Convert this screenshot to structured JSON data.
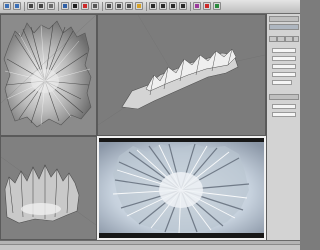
{
  "toolbar": {
    "buttons": [
      {
        "name": "undo-button",
        "icon": "undo-icon",
        "color": "#3b6fb6"
      },
      {
        "name": "redo-button",
        "icon": "redo-icon",
        "color": "#3b6fb6"
      },
      {
        "name": "link-button",
        "icon": "link-icon",
        "color": "#444444"
      },
      {
        "name": "unlink-button",
        "icon": "unlink-icon",
        "color": "#444444"
      },
      {
        "name": "bind-space-warp-button",
        "icon": "warp-icon",
        "color": "#6c6c6c"
      },
      {
        "name": "select-filter-button",
        "icon": "filter-icon",
        "color": "#2f5fa5"
      },
      {
        "name": "select-object-button",
        "icon": "arrow-icon",
        "color": "#1e1e1e"
      },
      {
        "name": "select-by-name-button",
        "icon": "list-icon",
        "color": "#cc2a2a"
      },
      {
        "name": "region-select-button",
        "icon": "region-icon",
        "color": "#555555"
      },
      {
        "name": "move-button",
        "icon": "move-icon",
        "color": "#4a4a4a"
      },
      {
        "name": "rotate-button",
        "icon": "rotate-icon",
        "color": "#4a4a4a"
      },
      {
        "name": "scale-button",
        "icon": "scale-icon",
        "color": "#4a4a4a"
      },
      {
        "name": "pivot-button",
        "icon": "pivot-icon",
        "color": "#d6a126"
      },
      {
        "name": "snap-button",
        "icon": "magnet-icon",
        "color": "#2b2b2b"
      },
      {
        "name": "angle-snap-button",
        "icon": "angle-snap-icon",
        "color": "#2b2b2b"
      },
      {
        "name": "mirror-button",
        "icon": "mirror-icon",
        "color": "#2b2b2b"
      },
      {
        "name": "align-button",
        "icon": "align-icon",
        "color": "#2b2b2b"
      },
      {
        "name": "material-editor-button",
        "icon": "material-icon",
        "color": "#9b3b9b"
      },
      {
        "name": "render-setup-button",
        "icon": "render-setup-icon",
        "color": "#cc2a2a"
      },
      {
        "name": "quick-render-button",
        "icon": "teapot-icon",
        "color": "#2b8a3e"
      }
    ]
  },
  "viewports": {
    "top": {
      "content": "terrain-top-view",
      "active": false
    },
    "perspective": {
      "content": "terrain-perspective-view",
      "active": false
    },
    "front": {
      "content": "terrain-front-view",
      "active": false
    },
    "camera": {
      "content": "terrain-rendered-view",
      "active": true
    }
  },
  "colors": {
    "viewport_bg": "#7c7c7c",
    "terrain_light": "#efefef",
    "terrain_dark": "#3f3f3f",
    "snow": "#dfe6ef",
    "panel": "#d3d3d3",
    "active_border": "#f2f2f2"
  }
}
